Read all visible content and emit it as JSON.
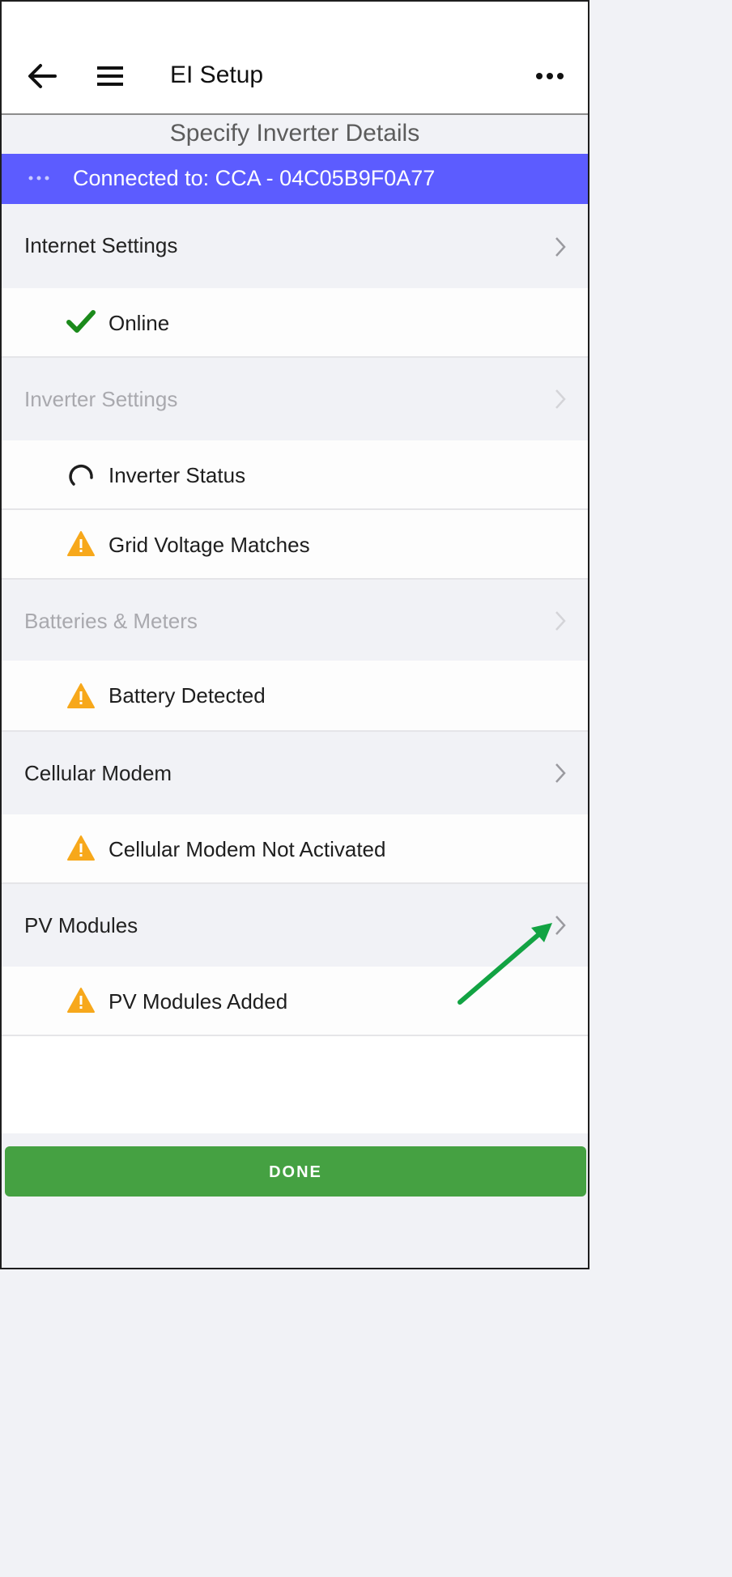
{
  "app_bar": {
    "title": "EI Setup"
  },
  "subheader": "Specify Inverter Details",
  "connection": {
    "text": "Connected to: CCA - 04C05B9F0A77"
  },
  "sections": [
    {
      "label": "Internet Settings",
      "enabled": true,
      "items": [
        {
          "icon": "check-icon",
          "label": "Online"
        }
      ]
    },
    {
      "label": "Inverter Settings",
      "enabled": false,
      "items": [
        {
          "icon": "spinner-icon",
          "label": "Inverter Status"
        },
        {
          "icon": "warning-icon",
          "label": "Grid Voltage Matches"
        }
      ]
    },
    {
      "label": "Batteries & Meters",
      "enabled": false,
      "items": [
        {
          "icon": "warning-icon",
          "label": "Battery Detected"
        }
      ]
    },
    {
      "label": "Cellular Modem",
      "enabled": true,
      "items": [
        {
          "icon": "warning-icon",
          "label": "Cellular Modem Not Activated"
        }
      ]
    },
    {
      "label": "PV Modules",
      "enabled": true,
      "items": [
        {
          "icon": "warning-icon",
          "label": "PV Modules Added"
        }
      ]
    }
  ],
  "done_button": {
    "label": "DONE"
  },
  "colors": {
    "connection_bar": "#5c5cff",
    "done_button": "#45a142",
    "check": "#1b8a1b",
    "warning": "#f7a81b",
    "annotation_arrow": "#12a343"
  }
}
